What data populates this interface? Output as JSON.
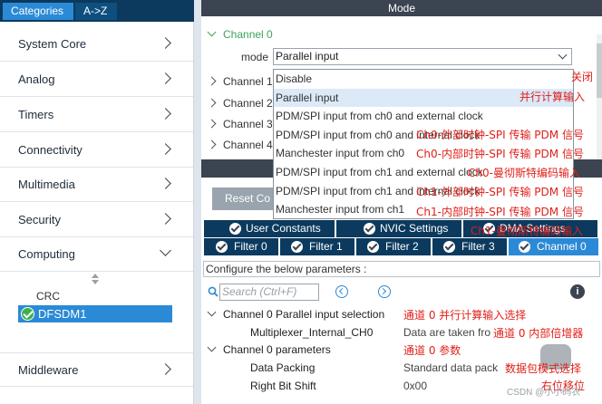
{
  "sidebar": {
    "tabs": [
      "Categories",
      "A->Z"
    ],
    "items": [
      {
        "label": "System Core",
        "expanded": false
      },
      {
        "label": "Analog",
        "expanded": false
      },
      {
        "label": "Timers",
        "expanded": false
      },
      {
        "label": "Connectivity",
        "expanded": false
      },
      {
        "label": "Multimedia",
        "expanded": false
      },
      {
        "label": "Security",
        "expanded": false
      },
      {
        "label": "Computing",
        "expanded": true
      },
      {
        "label": "Middleware",
        "expanded": false
      }
    ],
    "computing_children": {
      "crc": "CRC",
      "dfsdm": "DFSDM1"
    }
  },
  "mode": {
    "header": "Mode",
    "channels": [
      "Channel 0",
      "Channel 1",
      "Channel 2",
      "Channel 3",
      "Channel 4"
    ],
    "mode_label": "mode",
    "selected_value": "Parallel input",
    "options": [
      "Disable",
      "Parallel input",
      "PDM/SPI input from ch0 and external clock",
      "PDM/SPI input from ch0 and internal clock",
      "Manchester input from ch0",
      "PDM/SPI input from ch1 and external clock",
      "PDM/SPI input from ch1 and internal clock",
      "Manchester input from ch1"
    ],
    "selected_option_index": 1
  },
  "configuration": {
    "reset_button": "Reset Co",
    "tabs_row1": [
      "User Constants",
      "NVIC Settings",
      "DMA Settings"
    ],
    "tabs_row2": [
      "Filter 0",
      "Filter 1",
      "Filter 2",
      "Filter 3",
      "Channel 0"
    ],
    "active_tab": "Channel 0",
    "description": "Configure the below parameters :",
    "search_placeholder": "Search (Ctrl+F)",
    "info": "i",
    "params": [
      {
        "name": "Channel 0 Parallel input selection",
        "value": "",
        "group": true
      },
      {
        "name": "Multiplexer_Internal_CH0",
        "value": "Data are taken fro",
        "group": false
      },
      {
        "name": "Channel 0 parameters",
        "value": "",
        "group": true
      },
      {
        "name": "Data Packing",
        "value": "Standard data pack",
        "group": false
      },
      {
        "name": "Right Bit Shift",
        "value": "0x00",
        "group": false
      }
    ]
  },
  "annotations": [
    "关闭",
    "并行计算输入",
    "Ch0-外部时钟-SPI 传输 PDM 信号",
    "Ch0-内部时钟-SPI 传输 PDM 信号",
    "Ch0-曼彻斯特编码输入",
    "Ch1-外部时钟-SPI 传输 PDM 信号",
    "Ch1-内部时钟-SPI 传输 PDM 信号",
    "Ch1-曼彻斯特编码输入",
    "通道 0 并行计算输入选择",
    "通道 0 内部倍增器",
    "通道 0 参数",
    "数据包模式选择",
    "右位移位"
  ],
  "watermark": "CSDN @小小码农",
  "colors": {
    "header_dark": "#3b4450",
    "tab_navy": "#0b3a5e",
    "accent_blue": "#2b8ad6",
    "channel_green": "#3ba35a",
    "annotation_red": "#e0201a"
  }
}
